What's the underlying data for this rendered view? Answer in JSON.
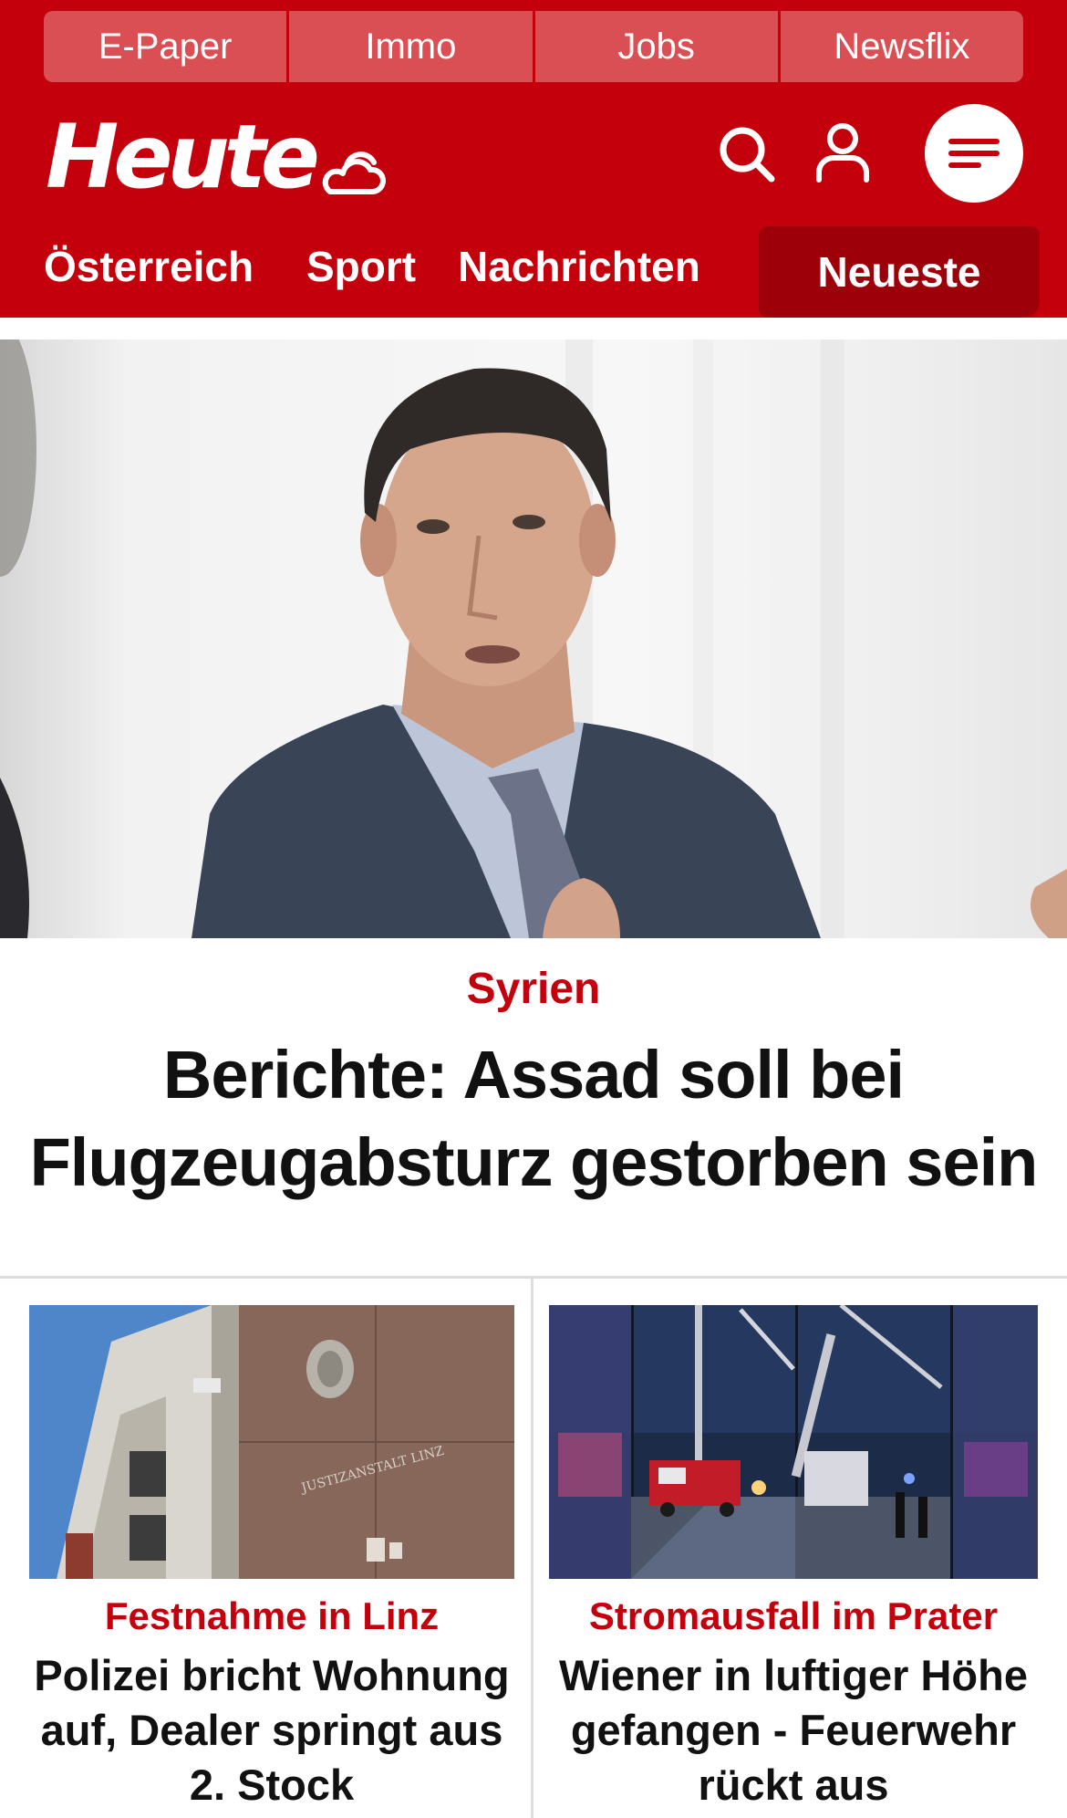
{
  "top_links": [
    "E-Paper",
    "Immo",
    "Jobs",
    "Newsflix"
  ],
  "brand": {
    "logo_text": "Heute"
  },
  "icons": {
    "weather": "cloud-sun-icon",
    "search": "search-icon",
    "user": "user-icon",
    "menu": "hamburger-menu-icon"
  },
  "nav": {
    "items": [
      "Österreich",
      "Sport",
      "Nachrichten"
    ],
    "active": "Neueste"
  },
  "hero": {
    "topic": "Syrien",
    "headline": "Berichte: Assad soll bei Flugzeugabsturz gestorben sein"
  },
  "articles": [
    {
      "topic": "Festnahme in Linz",
      "title": "Polizei bricht Wohnung auf, Dealer springt aus 2. Stock",
      "image_sign": "JUSTIZANSTALT LINZ"
    },
    {
      "topic": "Stromausfall im Prater",
      "title": "Wiener in luftiger Höhe gefangen - Feuerwehr rückt aus"
    }
  ],
  "colors": {
    "brand_red": "#c4000c",
    "top_link_bg": "#d94f54",
    "active_tab_bg": "#9e0009",
    "headline_text": "#111111"
  }
}
